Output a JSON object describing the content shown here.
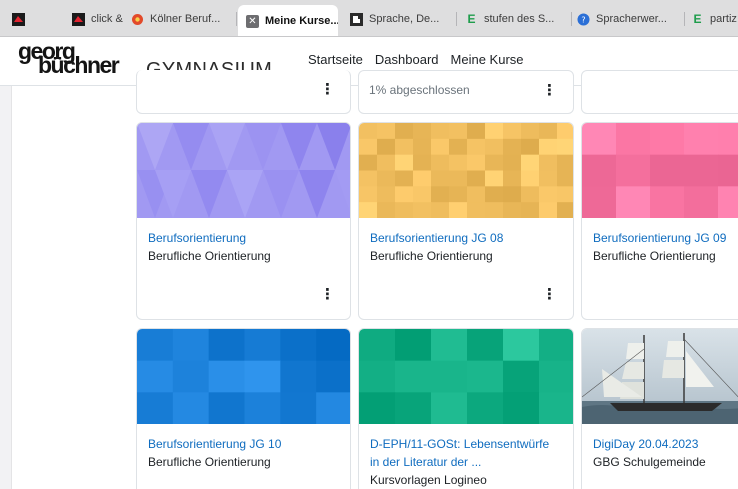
{
  "tabs": [
    {
      "label": "",
      "icon": "red-square-favicon-icon"
    },
    {
      "label": "click & ...",
      "icon": "red-square-favicon-icon"
    },
    {
      "label": "Kölner Beruf...",
      "icon": "flower-favicon-icon"
    },
    {
      "label": "Meine Kurse...",
      "icon": "close-icon",
      "active": true
    },
    {
      "label": "Sprache, De...",
      "icon": "puzzle-favicon-icon"
    },
    {
      "label": "stufen des S...",
      "icon": "green-e-favicon-icon"
    },
    {
      "label": "Spracherwer...",
      "icon": "blue-circle-favicon-icon"
    },
    {
      "label": "partiz",
      "icon": "green-e-favicon-icon"
    }
  ],
  "logo": {
    "line1": "georg",
    "line2": "büchner",
    "line3": "GYMNASIUM"
  },
  "nav": {
    "startseite": "Startseite",
    "dashboard": "Dashboard",
    "meine_kurse": "Meine Kurse"
  },
  "top_row": {
    "progress": "1% abgeschlossen"
  },
  "courses": [
    {
      "title": "Berufsorientierung",
      "category": "Berufliche Orientierung",
      "pattern": "triangles",
      "color": "#9b8fef"
    },
    {
      "title": "Berufsorientierung JG 08",
      "category": "Berufliche Orientierung",
      "pattern": "squares",
      "color": "#f2c061"
    },
    {
      "title": "Berufsorientierung JG 09",
      "category": "Berufliche Orientierung",
      "pattern": "squares",
      "color": "#f772a0"
    },
    {
      "title": "Berufsorientierung JG 10",
      "category": "Berufliche Orientierung",
      "pattern": "squares",
      "color": "#1a7fd8"
    },
    {
      "title": "D-EPH/11-GOSt: Lebensentwürfe",
      "title_line2": "in der Literatur der ...",
      "category": "Kursvorlagen Logineo",
      "pattern": "squares",
      "color": "#17b389"
    },
    {
      "title": "DigiDay 20.04.2023",
      "category": "GBG Schulgemeinde",
      "pattern": "photo",
      "color": "#c9d4dc"
    }
  ]
}
